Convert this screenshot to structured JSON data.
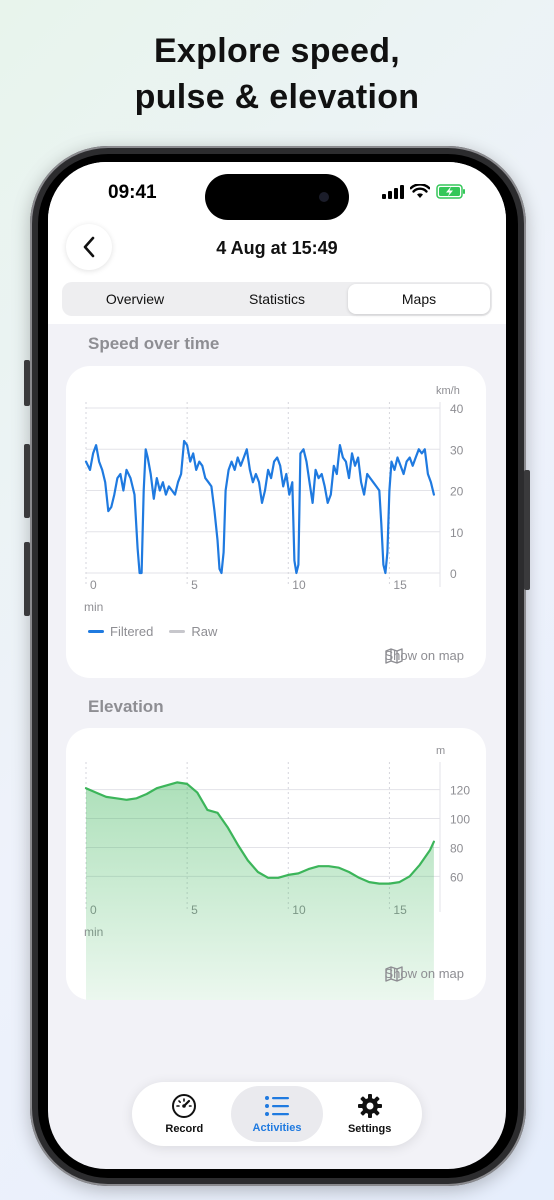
{
  "headline": {
    "line1": "Explore speed,",
    "line2": "pulse & elevation"
  },
  "status": {
    "time": "09:41"
  },
  "nav": {
    "title": "4 Aug at 15:49"
  },
  "segments": [
    {
      "label": "Overview",
      "active": false
    },
    {
      "label": "Statistics",
      "active": false
    },
    {
      "label": "Maps",
      "active": true
    }
  ],
  "speed_section": {
    "title": "Speed over time",
    "show_on_map": "Show on map"
  },
  "elevation_section": {
    "title": "Elevation",
    "show_on_map": "Show on map"
  },
  "tabbar": [
    {
      "label": "Record",
      "icon": "speedometer-icon",
      "active": false
    },
    {
      "label": "Activities",
      "icon": "list-icon",
      "active": true
    },
    {
      "label": "Settings",
      "icon": "gear-icon",
      "active": false
    }
  ],
  "colors": {
    "speed_line": "#1f7ae0",
    "elevation_line": "#3cb55a",
    "raw_line": "#c7c7cc",
    "active_tab": "#1f7ae0"
  },
  "chart_data": [
    {
      "type": "line",
      "title": "Speed over time",
      "xlabel": "min",
      "ylabel": "km/h",
      "xlim": [
        0,
        17.5
      ],
      "ylim": [
        0,
        40
      ],
      "x_ticks": [
        0,
        5,
        10,
        15
      ],
      "y_ticks": [
        0,
        10,
        20,
        30,
        40
      ],
      "legend": [
        "Filtered",
        "Raw"
      ],
      "series": [
        {
          "name": "Filtered",
          "x": [
            0,
            0.2,
            0.35,
            0.5,
            0.65,
            0.8,
            0.95,
            1.1,
            1.25,
            1.4,
            1.55,
            1.7,
            1.85,
            2.0,
            2.2,
            2.4,
            2.55,
            2.65,
            2.75,
            2.85,
            2.95,
            3.05,
            3.2,
            3.35,
            3.5,
            3.65,
            3.8,
            3.95,
            4.1,
            4.25,
            4.4,
            4.55,
            4.7,
            4.85,
            5.0,
            5.15,
            5.3,
            5.45,
            5.6,
            5.75,
            5.9,
            6.05,
            6.2,
            6.35,
            6.5,
            6.6,
            6.7,
            6.8,
            6.9,
            7.05,
            7.2,
            7.35,
            7.5,
            7.65,
            7.8,
            7.95,
            8.1,
            8.25,
            8.4,
            8.55,
            8.7,
            8.85,
            9.0,
            9.15,
            9.3,
            9.45,
            9.6,
            9.75,
            9.9,
            10.05,
            10.2,
            10.3,
            10.4,
            10.5,
            10.6,
            10.75,
            10.9,
            11.05,
            11.2,
            11.35,
            11.5,
            11.65,
            11.8,
            11.95,
            12.1,
            12.25,
            12.4,
            12.55,
            12.7,
            12.85,
            13.0,
            13.15,
            13.3,
            13.45,
            13.6,
            13.75,
            13.9,
            14.05,
            14.2,
            14.35,
            14.5,
            14.6,
            14.7,
            14.8,
            14.9,
            15.0,
            15.1,
            15.25,
            15.4,
            15.55,
            15.7,
            15.85,
            16.0,
            16.15,
            16.3,
            16.45,
            16.6,
            16.75,
            16.9,
            17.05,
            17.2
          ],
          "y": [
            27,
            25,
            29,
            31,
            27,
            25,
            22,
            15,
            16,
            19,
            23,
            24,
            20,
            25,
            23,
            19,
            6,
            0,
            0,
            20,
            30,
            28,
            24,
            18,
            23,
            20,
            22,
            19,
            21,
            20,
            19,
            22,
            24,
            32,
            31,
            27,
            29,
            25,
            27,
            26,
            23,
            22,
            21,
            15,
            8,
            1,
            0,
            5,
            20,
            25,
            27,
            25,
            28,
            26,
            28,
            30,
            25,
            22,
            24,
            22,
            17,
            20,
            25,
            23,
            27,
            28,
            26,
            21,
            24,
            19,
            22,
            3,
            0,
            2,
            29,
            30,
            27,
            22,
            17,
            25,
            23,
            24,
            21,
            17,
            19,
            26,
            24,
            31,
            28,
            27,
            23,
            29,
            26,
            28,
            22,
            19,
            24,
            23,
            22,
            21,
            20,
            12,
            2,
            0,
            5,
            20,
            27,
            25,
            28,
            26,
            24,
            27,
            28,
            26,
            28,
            30,
            29,
            30,
            24,
            22,
            19
          ],
          "color": "#1f7ae0"
        }
      ]
    },
    {
      "type": "area",
      "title": "Elevation",
      "xlabel": "min",
      "ylabel": "m",
      "xlim": [
        0,
        17.5
      ],
      "ylim": [
        45,
        135
      ],
      "x_ticks": [
        0,
        5,
        10,
        15
      ],
      "y_ticks": [
        60,
        80,
        100,
        120
      ],
      "series": [
        {
          "name": "Elevation",
          "x": [
            0,
            0.5,
            1,
            1.5,
            2,
            2.5,
            3,
            3.5,
            4,
            4.5,
            5,
            5.5,
            6,
            6.5,
            7,
            7.5,
            8,
            8.5,
            9,
            9.5,
            10,
            10.5,
            11,
            11.5,
            12,
            12.5,
            13,
            13.5,
            14,
            14.5,
            15,
            15.5,
            16,
            16.5,
            17,
            17.2
          ],
          "y": [
            121,
            118,
            115,
            114,
            113,
            114,
            117,
            121,
            123,
            125,
            124,
            118,
            106,
            104,
            94,
            82,
            71,
            63,
            59,
            59,
            61,
            62,
            65,
            67,
            67,
            66,
            63,
            59,
            56,
            55,
            55,
            56,
            60,
            68,
            78,
            84
          ],
          "color": "#3cb55a"
        }
      ]
    }
  ]
}
